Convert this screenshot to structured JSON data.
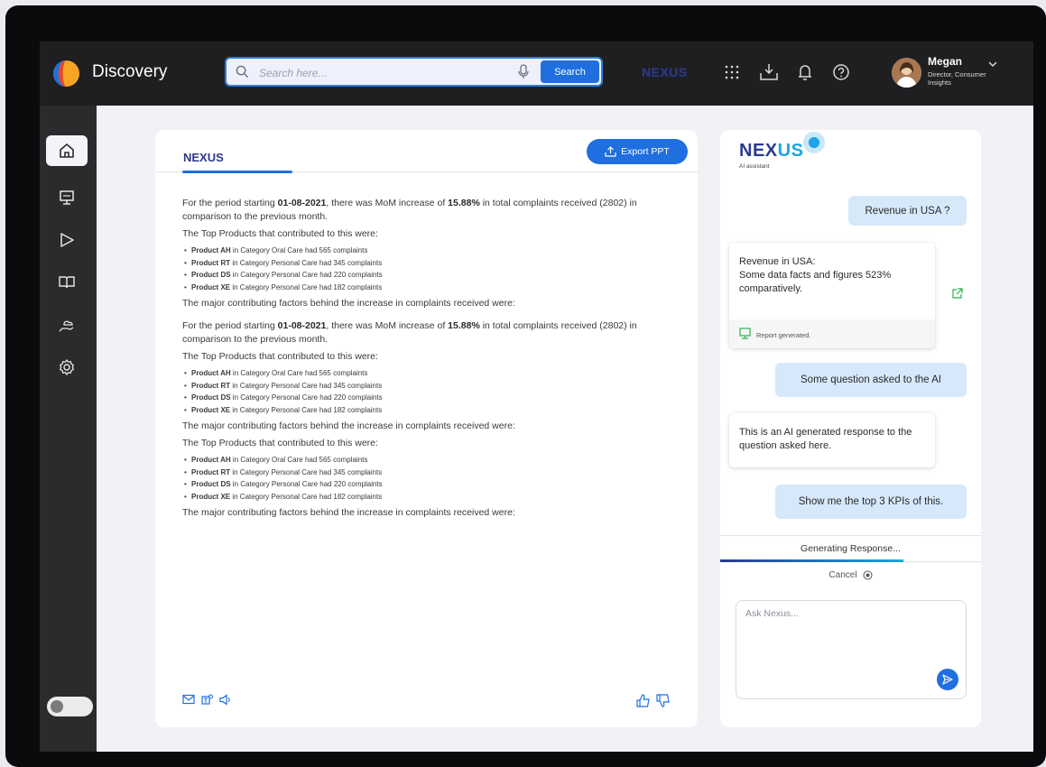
{
  "app": {
    "brand": "Discovery",
    "nexus_label": "NEXUS"
  },
  "search": {
    "placeholder": "Search here...",
    "button": "Search"
  },
  "user": {
    "name": "Megan",
    "role": "Director, Consumer Insights"
  },
  "sidebar": {
    "items": [
      "home-icon",
      "presentation-icon",
      "play-icon",
      "book-icon",
      "cloud-hand-icon",
      "settings-icon"
    ]
  },
  "main": {
    "tab": "NEXUS",
    "export_button": "Export PPT",
    "blocks": [
      {
        "intro_pre": "For the period starting ",
        "date": "01-08-2021",
        "intro_mid": ", there was MoM increase of ",
        "pct": "15.88%",
        "intro_post": " in total complaints received (2802) in comparison to the previous month."
      },
      {
        "intro_pre": "For the period starting ",
        "date": "01-08-2021",
        "intro_mid": ", there was MoM increase of ",
        "pct": "15.88%",
        "intro_post": " in total complaints received (2802) in comparison to the previous month."
      }
    ],
    "top_products": "The Top Products that contributed to this were:",
    "factors": "The major contributing factors behind the increase in complaints received were:",
    "products": [
      {
        "name": "Product AH",
        "rest": " in Category Oral Care had 565 complaints"
      },
      {
        "name": "Product RT",
        "rest": " in Category Personal Care had 345 complaints"
      },
      {
        "name": "Product DS",
        "rest": " in Category Personal Care had 220 complaints"
      },
      {
        "name": "Product XE",
        "rest": " in Category Personal Care had 182 complaints"
      }
    ]
  },
  "assistant": {
    "title_a": "NEX",
    "title_b": "US",
    "subtitle": "AI assistant",
    "q1": "Revenue in USA ?",
    "a1_title": "Revenue in USA:",
    "a1_body": "Some data facts and figures 523% comparatively.",
    "a1_footer": "Report generated.",
    "q2": "Some question asked to the AI",
    "a2": "This is an AI generated response to the question asked here.",
    "q3": "Show me the top 3 KPIs of this.",
    "generating": "Generating Response...",
    "cancel": "Cancel",
    "ask_placeholder": "Ask Nexus..."
  },
  "colors": {
    "accent": "#1f6fe0",
    "brand_navy": "#2b3a8f",
    "bubble": "#d6e9fb",
    "topbar": "#1f1f22",
    "sidebar": "#2b2b2e"
  }
}
